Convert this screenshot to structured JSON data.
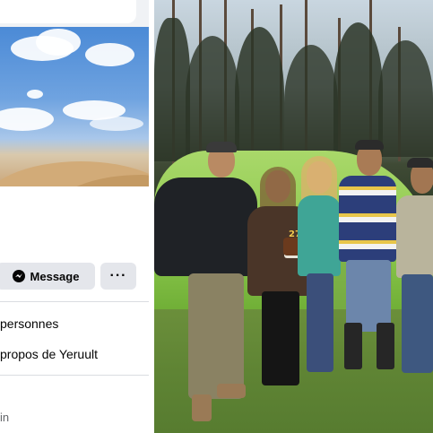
{
  "profile_panel": {
    "message_button_label": "Message",
    "more_button_label": "···",
    "followers_text": "personnes",
    "about_link_text": "propos de Yeruult",
    "bottom_partial_text": "in"
  },
  "colors": {
    "button_bg": "#e4e6eb",
    "text_primary": "#050505",
    "divider": "#dadde1"
  },
  "photo": {
    "cake_topper_text": "27"
  }
}
